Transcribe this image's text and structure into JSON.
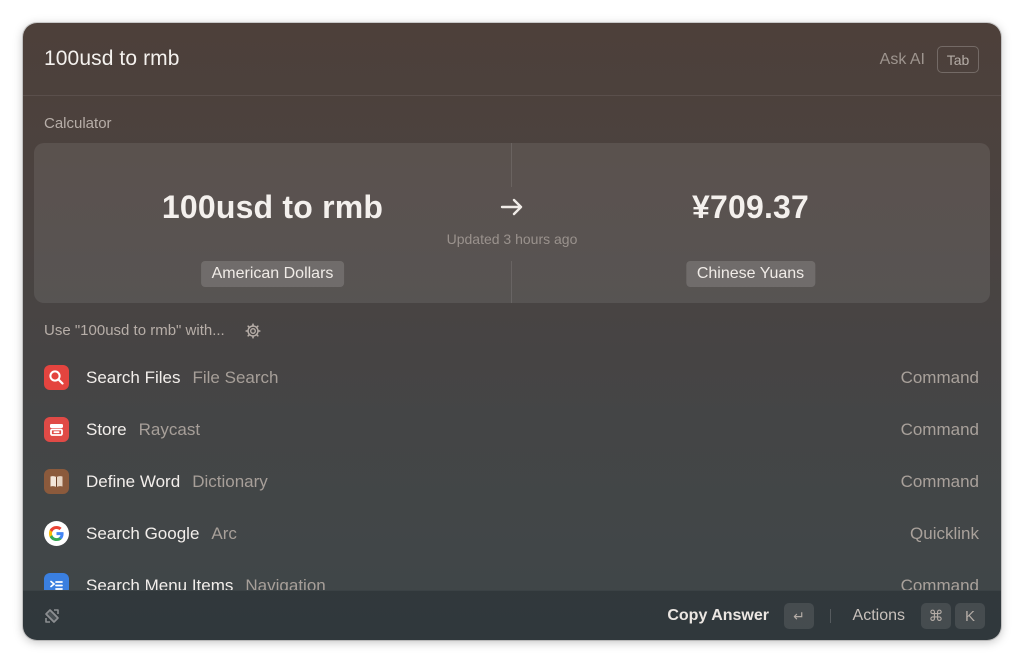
{
  "search": {
    "query": "100usd to rmb",
    "ask_ai_label": "Ask AI",
    "tab_key": "Tab"
  },
  "calculator": {
    "section_title": "Calculator",
    "input_value": "100usd to rmb",
    "input_unit": "American Dollars",
    "output_value": "¥709.37",
    "output_unit": "Chinese Yuans",
    "arrow": "→",
    "updated": "Updated 3 hours ago"
  },
  "use_with": {
    "label": "Use \"100usd to rmb\" with..."
  },
  "list": {
    "items": [
      {
        "title": "Search Files",
        "subtitle": "File Search",
        "type": "Command",
        "icon": "search-files-icon",
        "icon_color": "#e4443f"
      },
      {
        "title": "Store",
        "subtitle": "Raycast",
        "type": "Command",
        "icon": "store-icon",
        "icon_color": "#e04a46"
      },
      {
        "title": "Define Word",
        "subtitle": "Dictionary",
        "type": "Command",
        "icon": "dictionary-icon",
        "icon_color": "#8b5a3c"
      },
      {
        "title": "Search Google",
        "subtitle": "Arc",
        "type": "Quicklink",
        "icon": "google-icon",
        "icon_color": "#ffffff"
      },
      {
        "title": "Search Menu Items",
        "subtitle": "Navigation",
        "type": "Command",
        "icon": "menu-items-icon",
        "icon_color": "#3a7fe0"
      }
    ]
  },
  "footer": {
    "primary_action": "Copy Answer",
    "enter_key": "↵",
    "actions_label": "Actions",
    "cmd_key": "⌘",
    "k_key": "K"
  }
}
